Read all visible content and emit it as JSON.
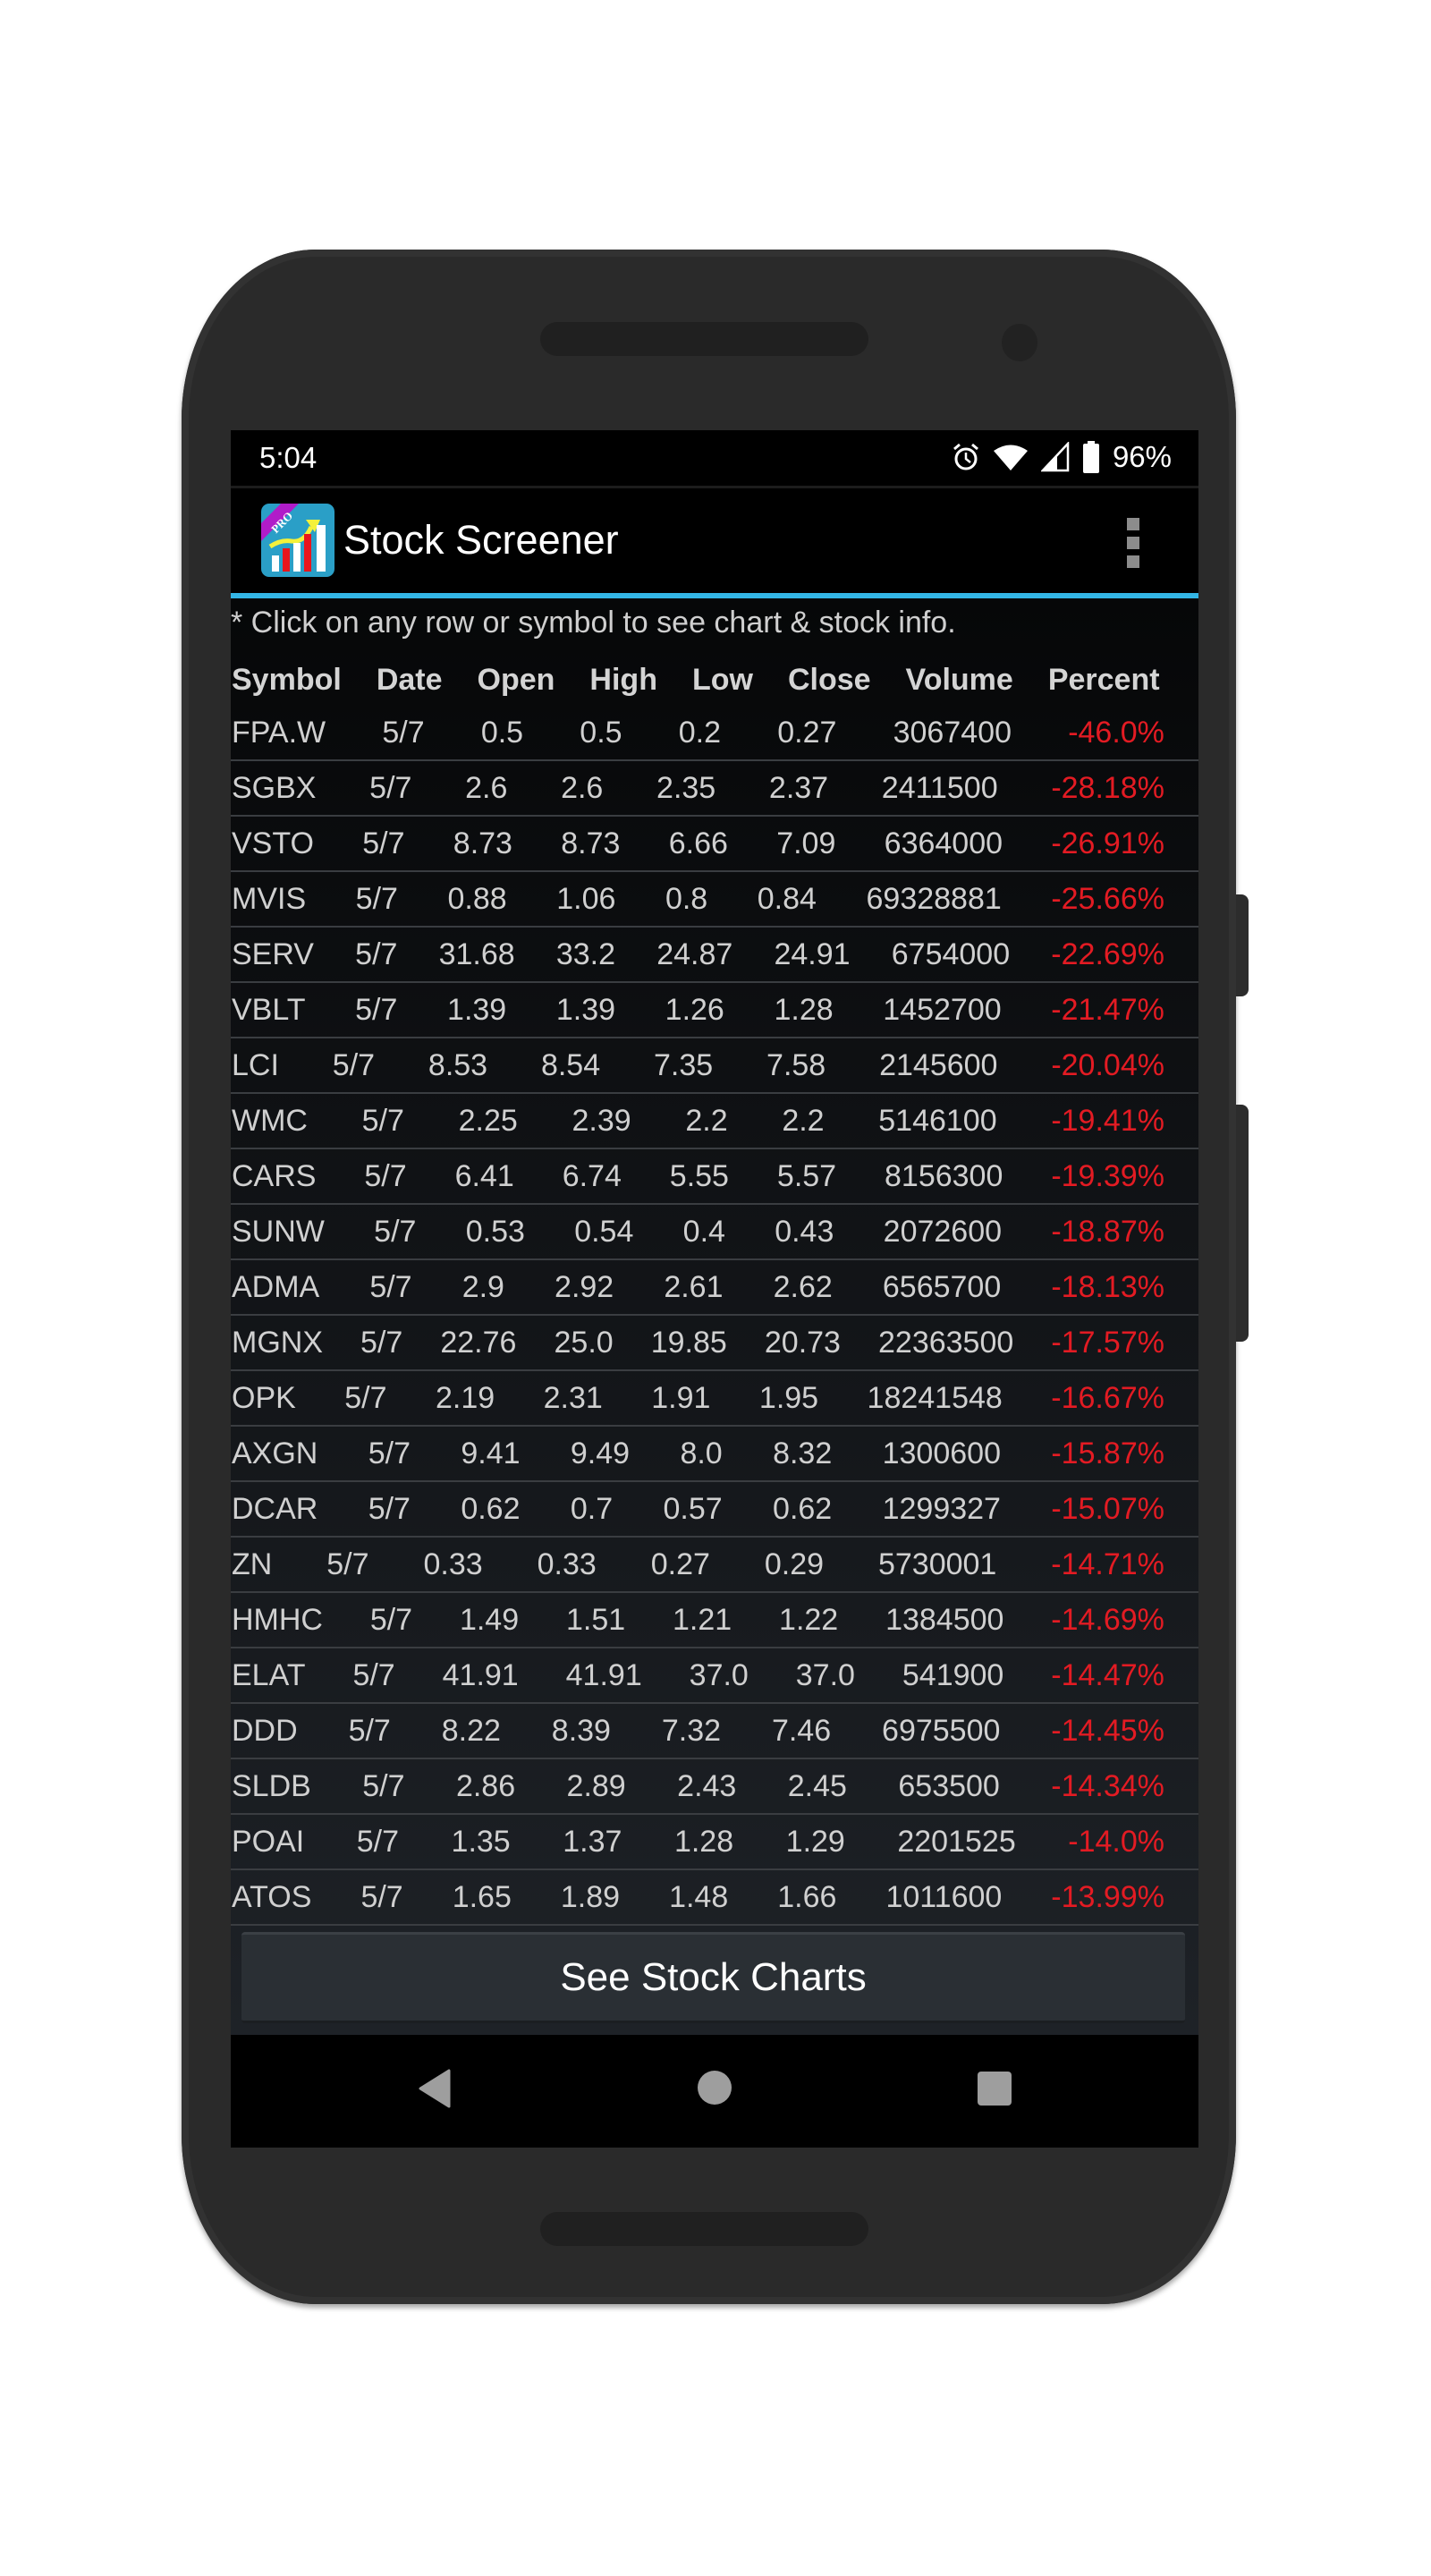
{
  "status_bar": {
    "time": "5:04",
    "icons": [
      "alarm-icon",
      "wifi-icon",
      "cell-signal-icon",
      "battery-icon"
    ],
    "battery": "96%"
  },
  "app_bar": {
    "title": "Stock Screener",
    "icon": "stock-screener-pro-app-icon",
    "menu_icon": "overflow-menu-icon",
    "accent_color": "#33b5e5"
  },
  "hint": "* Click on any row or symbol to see chart & stock info.",
  "table": {
    "headers": [
      "Symbol",
      "Date",
      "Open",
      "High",
      "Low",
      "Close",
      "Volume",
      "Percent"
    ],
    "negative_color": "#e31b23",
    "rows": [
      {
        "symbol": "FPA.W",
        "date": "5/7",
        "open": "0.5",
        "high": "0.5",
        "low": "0.2",
        "close": "0.27",
        "volume": "3067400",
        "percent": "-46.0%"
      },
      {
        "symbol": "SGBX",
        "date": "5/7",
        "open": "2.6",
        "high": "2.6",
        "low": "2.35",
        "close": "2.37",
        "volume": "2411500",
        "percent": "-28.18%"
      },
      {
        "symbol": "VSTO",
        "date": "5/7",
        "open": "8.73",
        "high": "8.73",
        "low": "6.66",
        "close": "7.09",
        "volume": "6364000",
        "percent": "-26.91%"
      },
      {
        "symbol": "MVIS",
        "date": "5/7",
        "open": "0.88",
        "high": "1.06",
        "low": "0.8",
        "close": "0.84",
        "volume": "69328881",
        "percent": "-25.66%"
      },
      {
        "symbol": "SERV",
        "date": "5/7",
        "open": "31.68",
        "high": "33.2",
        "low": "24.87",
        "close": "24.91",
        "volume": "6754000",
        "percent": "-22.69%"
      },
      {
        "symbol": "VBLT",
        "date": "5/7",
        "open": "1.39",
        "high": "1.39",
        "low": "1.26",
        "close": "1.28",
        "volume": "1452700",
        "percent": "-21.47%"
      },
      {
        "symbol": "LCI",
        "date": "5/7",
        "open": "8.53",
        "high": "8.54",
        "low": "7.35",
        "close": "7.58",
        "volume": "2145600",
        "percent": "-20.04%"
      },
      {
        "symbol": "WMC",
        "date": "5/7",
        "open": "2.25",
        "high": "2.39",
        "low": "2.2",
        "close": "2.2",
        "volume": "5146100",
        "percent": "-19.41%"
      },
      {
        "symbol": "CARS",
        "date": "5/7",
        "open": "6.41",
        "high": "6.74",
        "low": "5.55",
        "close": "5.57",
        "volume": "8156300",
        "percent": "-19.39%"
      },
      {
        "symbol": "SUNW",
        "date": "5/7",
        "open": "0.53",
        "high": "0.54",
        "low": "0.4",
        "close": "0.43",
        "volume": "2072600",
        "percent": "-18.87%"
      },
      {
        "symbol": "ADMA",
        "date": "5/7",
        "open": "2.9",
        "high": "2.92",
        "low": "2.61",
        "close": "2.62",
        "volume": "6565700",
        "percent": "-18.13%"
      },
      {
        "symbol": "MGNX",
        "date": "5/7",
        "open": "22.76",
        "high": "25.0",
        "low": "19.85",
        "close": "20.73",
        "volume": "22363500",
        "percent": "-17.57%"
      },
      {
        "symbol": "OPK",
        "date": "5/7",
        "open": "2.19",
        "high": "2.31",
        "low": "1.91",
        "close": "1.95",
        "volume": "18241548",
        "percent": "-16.67%"
      },
      {
        "symbol": "AXGN",
        "date": "5/7",
        "open": "9.41",
        "high": "9.49",
        "low": "8.0",
        "close": "8.32",
        "volume": "1300600",
        "percent": "-15.87%"
      },
      {
        "symbol": "DCAR",
        "date": "5/7",
        "open": "0.62",
        "high": "0.7",
        "low": "0.57",
        "close": "0.62",
        "volume": "1299327",
        "percent": "-15.07%"
      },
      {
        "symbol": "ZN",
        "date": "5/7",
        "open": "0.33",
        "high": "0.33",
        "low": "0.27",
        "close": "0.29",
        "volume": "5730001",
        "percent": "-14.71%"
      },
      {
        "symbol": "HMHC",
        "date": "5/7",
        "open": "1.49",
        "high": "1.51",
        "low": "1.21",
        "close": "1.22",
        "volume": "1384500",
        "percent": "-14.69%"
      },
      {
        "symbol": "ELAT",
        "date": "5/7",
        "open": "41.91",
        "high": "41.91",
        "low": "37.0",
        "close": "37.0",
        "volume": "541900",
        "percent": "-14.47%"
      },
      {
        "symbol": "DDD",
        "date": "5/7",
        "open": "8.22",
        "high": "8.39",
        "low": "7.32",
        "close": "7.46",
        "volume": "6975500",
        "percent": "-14.45%"
      },
      {
        "symbol": "SLDB",
        "date": "5/7",
        "open": "2.86",
        "high": "2.89",
        "low": "2.43",
        "close": "2.45",
        "volume": "653500",
        "percent": "-14.34%"
      },
      {
        "symbol": "POAI",
        "date": "5/7",
        "open": "1.35",
        "high": "1.37",
        "low": "1.28",
        "close": "1.29",
        "volume": "2201525",
        "percent": "-14.0%"
      },
      {
        "symbol": "ATOS",
        "date": "5/7",
        "open": "1.65",
        "high": "1.89",
        "low": "1.48",
        "close": "1.66",
        "volume": "1011600",
        "percent": "-13.99%"
      }
    ]
  },
  "button": {
    "label": "See Stock Charts"
  },
  "nav_bar": {
    "back": "back-icon",
    "home": "home-icon",
    "recents": "recents-icon"
  }
}
